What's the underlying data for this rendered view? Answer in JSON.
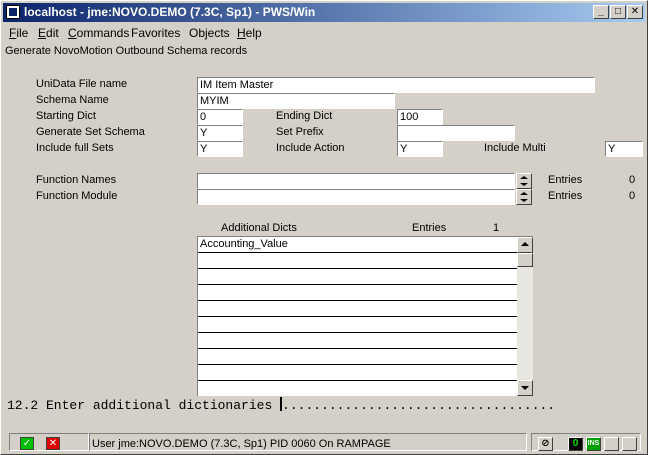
{
  "window": {
    "title": "localhost - jme:NOVO.DEMO (7.3C, Sp1) - PWS/Win",
    "controls": {
      "minimize": "_",
      "maximize": "□",
      "close": "✕"
    }
  },
  "menu": {
    "items": [
      {
        "label": "File",
        "accel": "F",
        "rest": "ile"
      },
      {
        "label": "Edit",
        "accel": "E",
        "rest": "dit"
      },
      {
        "label": "Commands",
        "accel": "C",
        "rest": "ommands"
      },
      {
        "label": "Favorites",
        "accel": "",
        "rest": "Favorites"
      },
      {
        "label": "Objects",
        "accel": "",
        "rest": "Objects"
      },
      {
        "label": "Help",
        "accel": "H",
        "rest": "elp"
      }
    ]
  },
  "subtitle": "Generate NovoMotion Outbound Schema records",
  "form": {
    "unidata_file_label": "UniData File name",
    "unidata_file_value": "IM  Item Master",
    "schema_name_label": "Schema Name",
    "schema_name_value": "MYIM",
    "starting_dict_label": "Starting Dict",
    "starting_dict_value": "0",
    "ending_dict_label": "Ending Dict",
    "ending_dict_value": "100",
    "generate_set_schema_label": "Generate Set Schema",
    "generate_set_schema_value": "Y",
    "set_prefix_label": "Set Prefix",
    "set_prefix_value": "",
    "include_full_sets_label": "Include full Sets",
    "include_full_sets_value": "Y",
    "include_action_label": "Include Action",
    "include_action_value": "Y",
    "include_multi_label": "Include Multi",
    "include_multi_value": "Y",
    "function_names_label": "Function Names",
    "function_names_value": "",
    "function_names_entries_label": "Entries",
    "function_names_entries_count": "0",
    "function_module_label": "Function Module",
    "function_module_value": "",
    "function_module_entries_label": "Entries",
    "function_module_entries_count": "0"
  },
  "additional_dicts": {
    "header": "Additional Dicts",
    "entries_label": "Entries",
    "entries_count": "1",
    "rows": [
      "Accounting_Value",
      "",
      "",
      "",
      "",
      "",
      "",
      "",
      "",
      ""
    ]
  },
  "prompt": {
    "text": "12.2 Enter additional dictionaries ",
    "dots": "..................................."
  },
  "statusbar": {
    "ok_icon": "check-icon",
    "cancel_icon": "x-icon",
    "ok_symbol": "✓",
    "cancel_symbol": "✕",
    "status_text": "User jme:NOVO.DEMO (7.3C, Sp1) PID 0060 On RAMPAGE",
    "indicator_zero": "0",
    "indicator_ins": "INS",
    "colors": {
      "ok": "#00c000",
      "cancel": "#e00000",
      "ins": "#00a000"
    }
  }
}
